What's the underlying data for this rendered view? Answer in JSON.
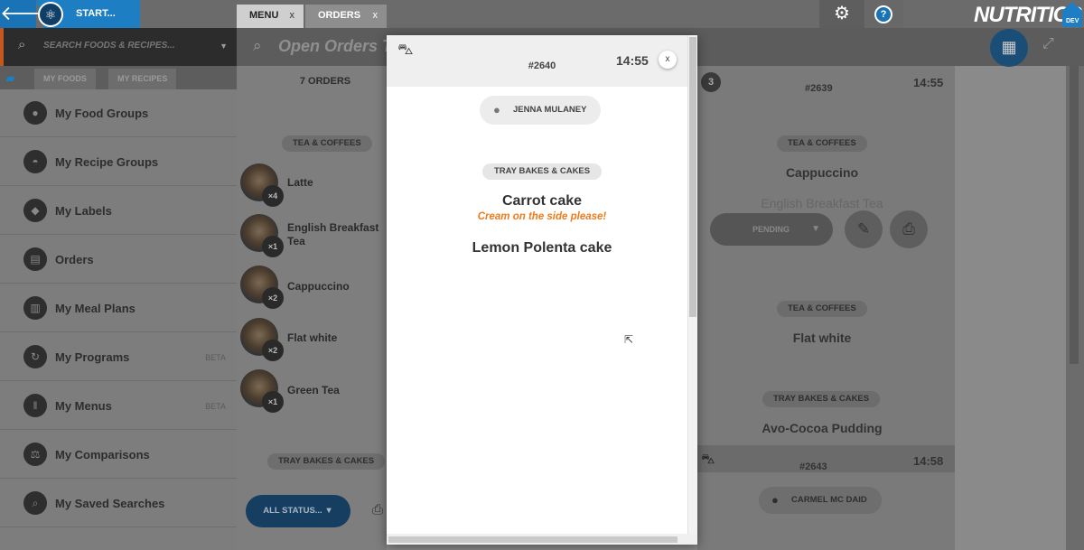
{
  "topbar": {
    "start_label": "START...",
    "tabs": [
      {
        "label": "MENU",
        "close": "x"
      },
      {
        "label": "ORDERS",
        "close": "x"
      }
    ],
    "help_label": "?",
    "brand": "NUTRITICS",
    "brand_badge": "DEV"
  },
  "search": {
    "placeholder": "SEARCH FOODS & RECIPES...",
    "dropdown_arrow": "▼"
  },
  "header": {
    "title": "Open Orders T"
  },
  "library_tabs": [
    {
      "label": "MY FOODS"
    },
    {
      "label": "MY RECIPES"
    }
  ],
  "sidebar": {
    "items": [
      {
        "label": "My Food Groups",
        "icon": "apple-icon",
        "glyph": "●"
      },
      {
        "label": "My Recipe Groups",
        "icon": "chef-hat-icon",
        "glyph": "◓"
      },
      {
        "label": "My Labels",
        "icon": "tag-icon",
        "glyph": "◆"
      },
      {
        "label": "Orders",
        "icon": "receipt-icon",
        "glyph": "▤"
      },
      {
        "label": "My Meal Plans",
        "icon": "clipboard-icon",
        "glyph": "▥"
      },
      {
        "label": "My Programs",
        "icon": "cycle-icon",
        "glyph": "↻",
        "badge": "BETA"
      },
      {
        "label": "My Menus",
        "icon": "cutlery-icon",
        "glyph": "ǁ",
        "badge": "BETA"
      },
      {
        "label": "My Comparisons",
        "icon": "scales-icon",
        "glyph": "⚖"
      },
      {
        "label": "My Saved Searches",
        "icon": "search-icon",
        "glyph": "⌕"
      }
    ]
  },
  "orders_list": {
    "count_label": "7 ORDERS",
    "sections": [
      {
        "category": "TEA & COFFEES",
        "items": [
          {
            "name": "Latte",
            "qty": "×4"
          },
          {
            "name": "English Breakfast Tea",
            "qty": "×1"
          },
          {
            "name": "Cappuccino",
            "qty": "×2"
          },
          {
            "name": "Flat white",
            "qty": "×2"
          },
          {
            "name": "Green Tea",
            "qty": "×1"
          }
        ]
      },
      {
        "category": "TRAY BAKES & CAKES",
        "items": []
      }
    ],
    "filter_label": "ALL STATUS...",
    "filter_arrow": "▼"
  },
  "modal": {
    "order_id": "#2640",
    "time": "14:55",
    "close": "x",
    "customer": "JENNA MULANEY",
    "category": "TRAY BAKES & CAKES",
    "items": [
      {
        "name": "Carrot cake",
        "note": "Cream on the side please!"
      },
      {
        "name": "Lemon Polenta cake"
      }
    ]
  },
  "right_panel": {
    "order_2639": {
      "badge": "3",
      "id": "#2639",
      "time": "14:55",
      "category": "TEA & COFFEES",
      "items": [
        "Cappuccino",
        "English Breakfast Tea"
      ],
      "status": "PENDING",
      "status_arrow": "▼"
    },
    "order_2639_more": {
      "sections": [
        {
          "category": "TEA & COFFEES",
          "item": "Flat white"
        },
        {
          "category": "TRAY BAKES & CAKES",
          "item": "Avo-Cocoa Pudding"
        }
      ]
    },
    "order_2643": {
      "id": "#2643",
      "time": "14:58",
      "customer": "CARMEL MC DAID"
    }
  },
  "colors": {
    "accent_blue": "#1e7ec3",
    "note_orange": "#f07b1a",
    "search_accent": "#c5561d"
  }
}
